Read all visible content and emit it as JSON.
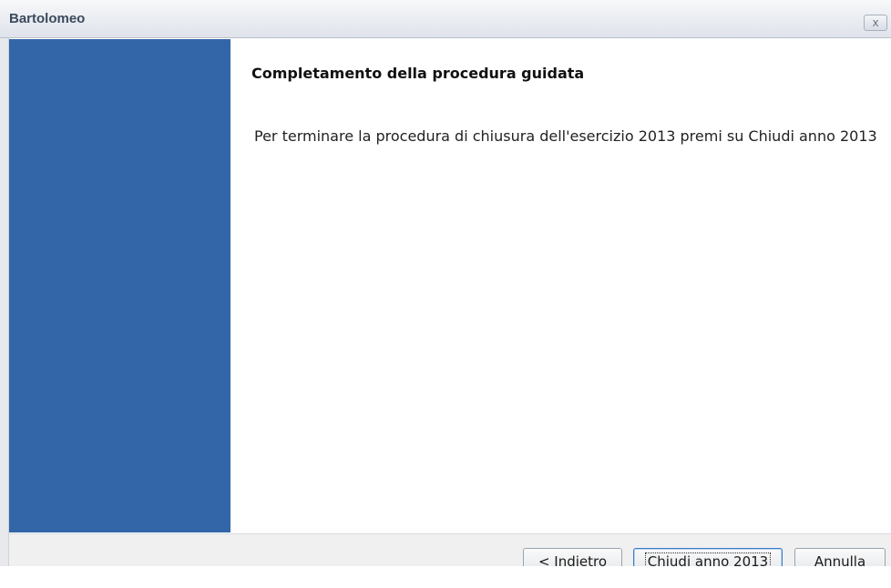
{
  "window": {
    "title": "Bartolomeo",
    "close_glyph": "x"
  },
  "content": {
    "heading": "Completamento della procedura guidata",
    "message": "Per terminare la procedura di chiusura dell'esercizio 2013 premi su Chiudi anno 2013"
  },
  "buttons": {
    "back_prefix": "< ",
    "back_mnemonic": "I",
    "back_rest": "ndietro",
    "finish": "Chiudi anno 2013",
    "cancel": "Annulla"
  },
  "colors": {
    "side_panel": "#3366a8",
    "footer": "#f0f0f0"
  }
}
